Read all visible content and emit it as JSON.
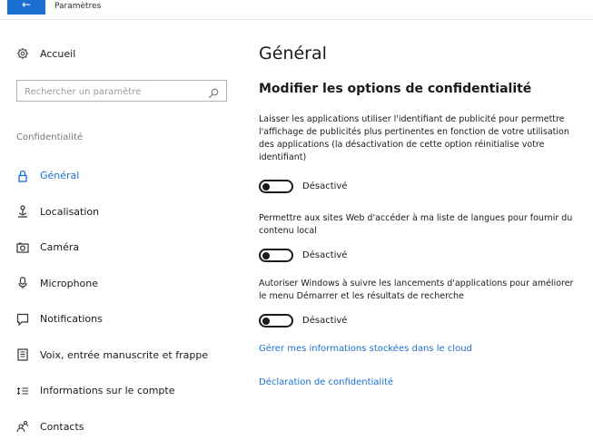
{
  "window": {
    "title": "Paramètres"
  },
  "sidebar": {
    "home_label": "Accueil",
    "search_placeholder": "Rechercher un paramètre",
    "section_label": "Confidentialité",
    "items": [
      {
        "label": "Général",
        "icon": "lock-icon",
        "active": true
      },
      {
        "label": "Localisation",
        "icon": "location-icon",
        "active": false
      },
      {
        "label": "Caméra",
        "icon": "camera-icon",
        "active": false
      },
      {
        "label": "Microphone",
        "icon": "microphone-icon",
        "active": false
      },
      {
        "label": "Notifications",
        "icon": "notification-icon",
        "active": false
      },
      {
        "label": "Voix, entrée manuscrite et frappe",
        "icon": "keyboard-icon",
        "active": false
      },
      {
        "label": "Informations sur le compte",
        "icon": "account-info-icon",
        "active": false
      },
      {
        "label": "Contacts",
        "icon": "contacts-icon",
        "active": false
      }
    ]
  },
  "main": {
    "title": "Général",
    "section_title": "Modifier les options de confidentialité",
    "options": [
      {
        "description": "Laisser les applications utiliser l'identifiant de publicité pour permettre l'affichage de publicités plus pertinentes en fonction de votre utilisation des applications (la désactivation de cette option réinitialise votre identifiant)",
        "state_label": "Désactivé",
        "on": false
      },
      {
        "description": "Permettre aux sites Web d'accéder à ma liste de langues pour fournir du contenu local",
        "state_label": "Désactivé",
        "on": false
      },
      {
        "description": "Autoriser Windows à suivre les lancements d'applications pour améliorer le menu Démarrer et les résultats de recherche",
        "state_label": "Désactivé",
        "on": false
      }
    ],
    "links": [
      {
        "label": "Gérer mes informations stockées dans le cloud"
      },
      {
        "label": "Déclaration de confidentialité"
      }
    ]
  },
  "colors": {
    "accent": "#1a6fd0",
    "text": "#1a1a1a",
    "muted": "#777777"
  }
}
